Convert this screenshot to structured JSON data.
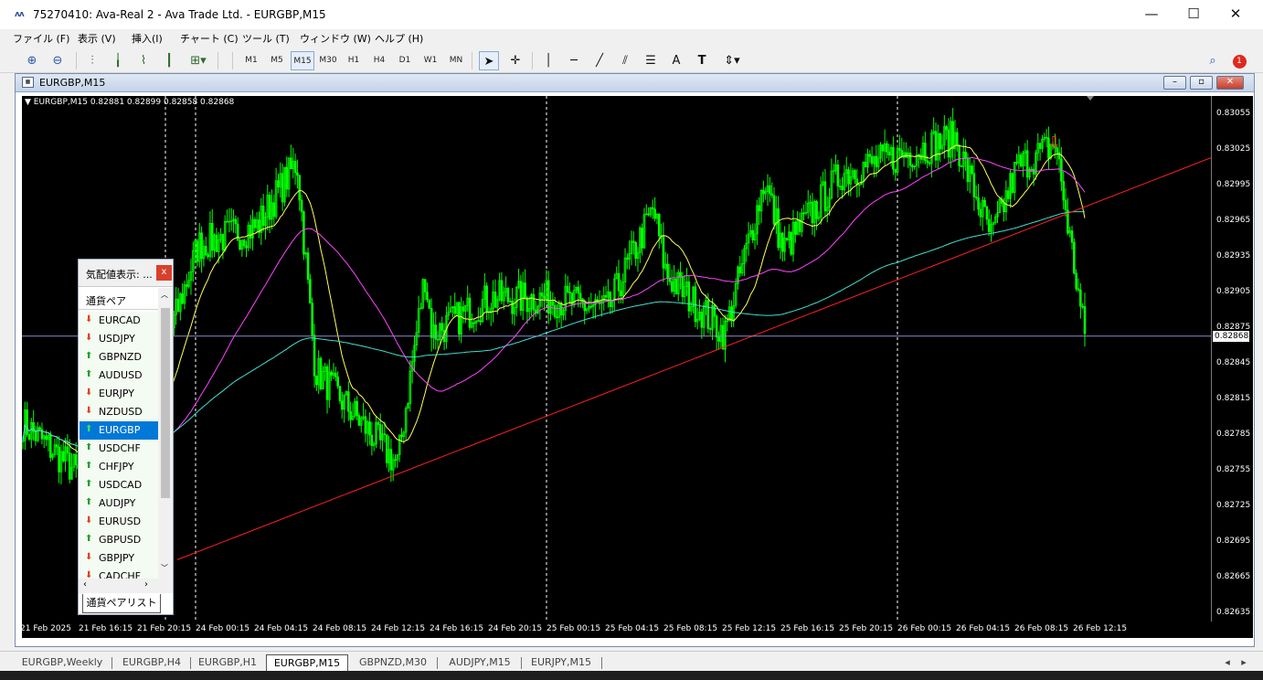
{
  "app": {
    "title": "75270410: Ava-Real 2 - Ava Trade Ltd. - EURGBP,M15",
    "logo": "ᴧᴧ"
  },
  "window_controls": {
    "minimize": "—",
    "maximize": "☐",
    "close": "✕"
  },
  "menu": [
    "ファイル (F)",
    "表示 (V)",
    "挿入(I)",
    "チャート (C)",
    "ツール (T)",
    "ウィンドウ (W)",
    "ヘルプ (H)"
  ],
  "toolbar": {
    "timeframes": [
      "M1",
      "M5",
      "M15",
      "M30",
      "H1",
      "H4",
      "D1",
      "W1",
      "MN"
    ],
    "selected_timeframe": "M15",
    "text_tool": "A",
    "label_tool": "T",
    "notification_count": "1"
  },
  "chart_window": {
    "title": "EURGBP,M15",
    "btn_min": "–",
    "btn_max": "▫",
    "btn_close": "✕"
  },
  "chart_data": {
    "type": "candlestick",
    "symbol_info": "▼ EURGBP,M15  0.82881 0.82899 0.82858 0.82868",
    "current_price": "0.82868",
    "y_ticks": [
      "0.83055",
      "0.83025",
      "0.82995",
      "0.82965",
      "0.82935",
      "0.82905",
      "0.82875",
      "0.82845",
      "0.82815",
      "0.82785",
      "0.82755",
      "0.82725",
      "0.82695",
      "0.82665",
      "0.82635"
    ],
    "ylim": [
      0.82628,
      0.8307
    ],
    "x_ticks": [
      "21 Feb 2025",
      "21 Feb 16:15",
      "21 Feb 20:15",
      "24 Feb 00:15",
      "24 Feb 04:15",
      "24 Feb 08:15",
      "24 Feb 12:15",
      "24 Feb 16:15",
      "24 Feb 20:15",
      "25 Feb 00:15",
      "25 Feb 04:15",
      "25 Feb 08:15",
      "25 Feb 12:15",
      "25 Feb 16:15",
      "25 Feb 20:15",
      "26 Feb 00:15",
      "26 Feb 04:15",
      "26 Feb 08:15",
      "26 Feb 12:15"
    ],
    "key_points": [
      {
        "label": "21 Feb 2025",
        "close": 0.82795
      },
      {
        "label": "21 Feb 16:15",
        "close": 0.8275
      },
      {
        "label": "21 Feb 20:15",
        "close": 0.8279
      },
      {
        "label": "24 Feb 00:15",
        "close": 0.82945
      },
      {
        "label": "24 Feb 04:15",
        "close": 0.8296
      },
      {
        "label": "24 Feb 06:15",
        "close": 0.83015
      },
      {
        "label": "24 Feb 08:15",
        "close": 0.8284
      },
      {
        "label": "24 Feb 12:15",
        "close": 0.8276
      },
      {
        "label": "24 Feb 13:15",
        "close": 0.8292
      },
      {
        "label": "24 Feb 16:15",
        "close": 0.8287
      },
      {
        "label": "24 Feb 20:15",
        "close": 0.829
      },
      {
        "label": "25 Feb 00:15",
        "close": 0.829
      },
      {
        "label": "25 Feb 04:15",
        "close": 0.8289
      },
      {
        "label": "25 Feb 06:15",
        "close": 0.82975
      },
      {
        "label": "25 Feb 08:15",
        "close": 0.8292
      },
      {
        "label": "25 Feb 12:15",
        "close": 0.8287
      },
      {
        "label": "25 Feb 13:15",
        "close": 0.83
      },
      {
        "label": "25 Feb 16:15",
        "close": 0.8294
      },
      {
        "label": "25 Feb 20:15",
        "close": 0.83005
      },
      {
        "label": "26 Feb 00:15",
        "close": 0.8302
      },
      {
        "label": "26 Feb 03:15",
        "close": 0.83035
      },
      {
        "label": "26 Feb 06:15",
        "close": 0.8295
      },
      {
        "label": "26 Feb 08:15",
        "close": 0.8301
      },
      {
        "label": "26 Feb 09:15",
        "close": 0.8303
      },
      {
        "label": "26 Feb 11:15",
        "close": 0.82868
      }
    ],
    "indicators": [
      {
        "name": "MA short",
        "color": "#ffff55"
      },
      {
        "name": "MA medium",
        "color": "#ff44ff"
      },
      {
        "name": "MA long",
        "color": "#40e0d0"
      },
      {
        "name": "trend line",
        "color": "#ff2020"
      }
    ],
    "colors": {
      "candle": "#00ff00",
      "background": "#000000",
      "price_line": "#8a8ad0",
      "grid_vline": "#ffffff"
    },
    "arrow_marker": "⇩"
  },
  "market_watch": {
    "title": "気配値表示: ...",
    "close": "x",
    "column_header": "通貨ペア",
    "rows": [
      {
        "symbol": "EURCAD",
        "dir": "down"
      },
      {
        "symbol": "USDJPY",
        "dir": "down"
      },
      {
        "symbol": "GBPNZD",
        "dir": "up"
      },
      {
        "symbol": "AUDUSD",
        "dir": "up"
      },
      {
        "symbol": "EURJPY",
        "dir": "down"
      },
      {
        "symbol": "NZDUSD",
        "dir": "down"
      },
      {
        "symbol": "EURGBP",
        "dir": "up"
      },
      {
        "symbol": "USDCHF",
        "dir": "up"
      },
      {
        "symbol": "CHFJPY",
        "dir": "up"
      },
      {
        "symbol": "USDCAD",
        "dir": "up"
      },
      {
        "symbol": "AUDJPY",
        "dir": "up"
      },
      {
        "symbol": "EURUSD",
        "dir": "down"
      },
      {
        "symbol": "GBPUSD",
        "dir": "up"
      },
      {
        "symbol": "GBPJPY",
        "dir": "down"
      },
      {
        "symbol": "CADCHF",
        "dir": "down"
      }
    ],
    "selected": "EURGBP",
    "tab": "通貨ペアリスト"
  },
  "bottom_tabs": [
    "EURGBP,Weekly",
    "EURGBP,H4",
    "EURGBP,H1",
    "EURGBP,M15",
    "GBPNZD,M30",
    "AUDJPY,M15",
    "EURJPY,M15"
  ],
  "active_tab": "EURGBP,M15"
}
